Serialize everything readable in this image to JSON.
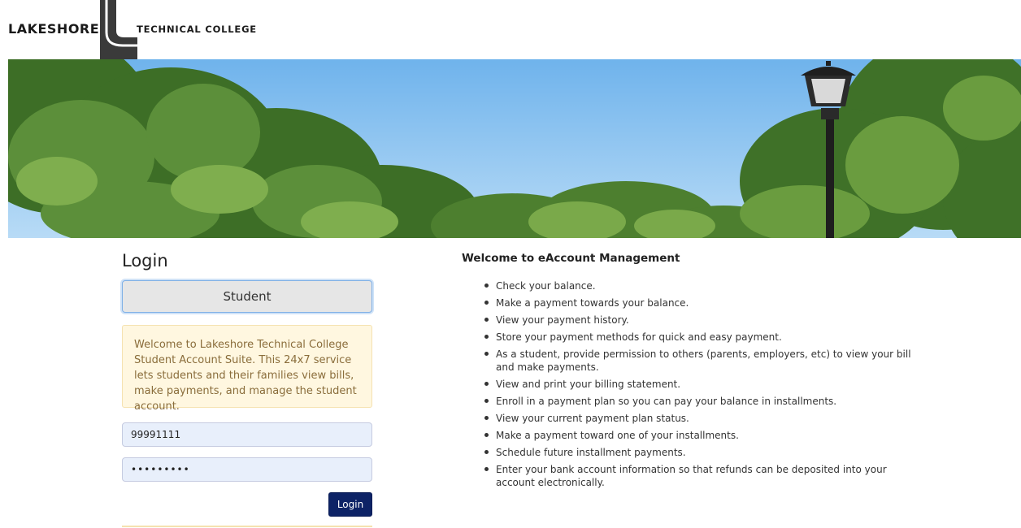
{
  "logo": {
    "left_text": "LAKESHORE",
    "right_text": "TECHNICAL COLLEGE"
  },
  "login": {
    "title": "Login",
    "role_button": "Student",
    "welcome_text": "Welcome to Lakeshore Technical College Student Account Suite. This 24x7 service lets students and their families view bills, make payments, and manage the student account.",
    "username_value": "99991111",
    "password_value": "•••••••••",
    "submit_label": "Login"
  },
  "info": {
    "title": "Welcome to eAccount Management",
    "items": [
      "Check your balance.",
      "Make a payment towards your balance.",
      "View your payment history.",
      "Store your payment methods for quick and easy payment.",
      "As a student, provide permission to others (parents, employers, etc) to view your bill and make payments.",
      "View and print your billing statement.",
      "Enroll in a payment plan so you can pay your balance in installments.",
      "View your current payment plan status.",
      "Make a payment toward one of your installments.",
      "Schedule future installment payments.",
      "Enter your bank account information so that refunds can be deposited into your account electronically."
    ]
  },
  "colors": {
    "login_button": "#0d2366",
    "welcome_bg": "#fff7e0",
    "welcome_text": "#8a6d3b",
    "field_bg": "#e8effb"
  }
}
